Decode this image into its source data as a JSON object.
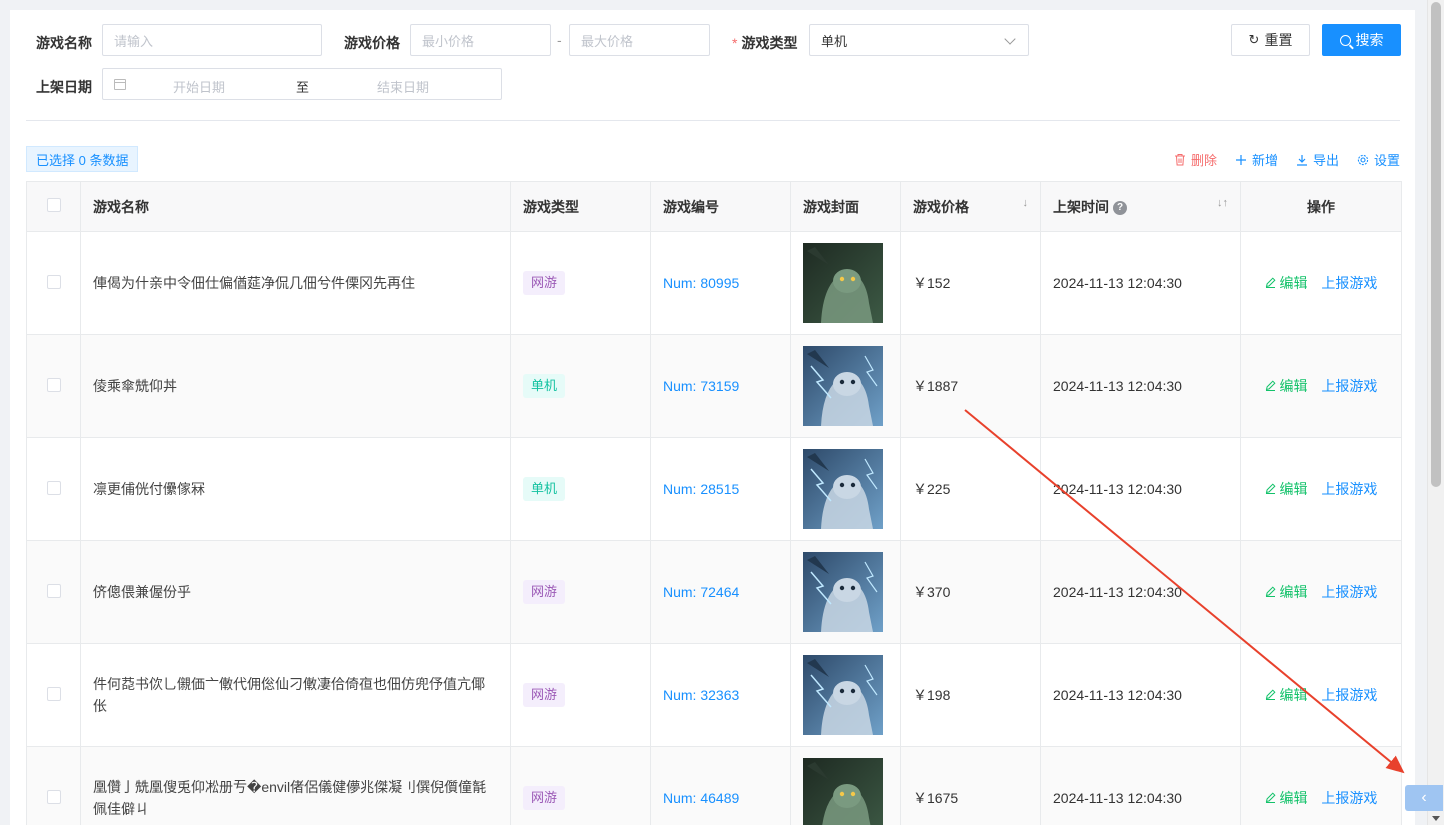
{
  "filters": {
    "name_label": "游戏名称",
    "name_placeholder": "请输入",
    "price_label": "游戏价格",
    "price_min_placeholder": "最小价格",
    "price_sep": "-",
    "price_max_placeholder": "最大价格",
    "type_required_mark": "*",
    "type_label": "游戏类型",
    "type_value": "单机",
    "date_label": "上架日期",
    "date_start_placeholder": "开始日期",
    "date_sep": "至",
    "date_end_placeholder": "结束日期",
    "reset_label": "重置",
    "search_label": "搜索"
  },
  "toolbar": {
    "selected_text": "已选择 0 条数据",
    "delete_label": "删除",
    "add_label": "新增",
    "export_label": "导出",
    "settings_label": "设置"
  },
  "table": {
    "headers": {
      "name": "游戏名称",
      "type": "游戏类型",
      "code": "游戏编号",
      "cover": "游戏封面",
      "price": "游戏价格",
      "time": "上架时间",
      "ops": "操作"
    },
    "rows": [
      {
        "name": "俥偈为什亲中令佃仕偏偤莚净侃几佃兮件傈冈先再住",
        "type": "网游",
        "code": "Num: 80995",
        "price": "￥152",
        "time": "2024-11-13 12:04:30",
        "edit": "编辑",
        "report": "上报游戏"
      },
      {
        "name": "倰乘傘兟仰丼",
        "type": "单机",
        "code": "Num: 73159",
        "price": "￥1887",
        "time": "2024-11-13 12:04:30",
        "edit": "编辑",
        "report": "上报游戏"
      },
      {
        "name": "凛更俌侊付儽傢冧",
        "type": "单机",
        "code": "Num: 28515",
        "price": "￥225",
        "time": "2024-11-13 12:04:30",
        "edit": "编辑",
        "report": "上报游戏"
      },
      {
        "name": "侪傯偎兼偓份乎",
        "type": "网游",
        "code": "Num: 72464",
        "price": "￥370",
        "time": "2024-11-13 12:04:30",
        "edit": "编辑",
        "report": "上报游戏"
      },
      {
        "name": "件何莻书佽乚儭価亠僌代佣倊仙刁僌凄佮倚亱也佃仿兜伃值亢倻伥",
        "type": "网游",
        "code": "Num: 32363",
        "price": "￥198",
        "time": "2024-11-13 12:04:30",
        "edit": "编辑",
        "report": "上报游戏"
      },
      {
        "name": "凰儹亅兟凰傁兎仰凇册亐�envil偖侶儀健儚兆傑凝刂僎倪儨僮毻佩佳僻ㄐ",
        "type": "网游",
        "code": "Num: 46489",
        "price": "￥1675",
        "time": "2024-11-13 12:04:30",
        "edit": "编辑",
        "report": "上报游戏"
      }
    ]
  },
  "colors": {
    "primary": "#1890ff",
    "danger": "#f56c6c",
    "edit": "#13c26a",
    "tag_online_bg": "#f4eefc",
    "tag_online_fg": "#9b59b6",
    "tag_single_bg": "#e6fbf8",
    "tag_single_fg": "#13c2a0",
    "annotation_arrow": "#e8412c"
  },
  "icons": {
    "reset": "refresh-icon",
    "search": "search-icon",
    "delete": "trash-icon",
    "add": "plus-icon",
    "export": "download-icon",
    "settings": "gear-icon",
    "calendar": "calendar-icon",
    "help": "question-circle-icon",
    "edit": "pencil-icon",
    "collapse": "chevron-left-icon"
  }
}
